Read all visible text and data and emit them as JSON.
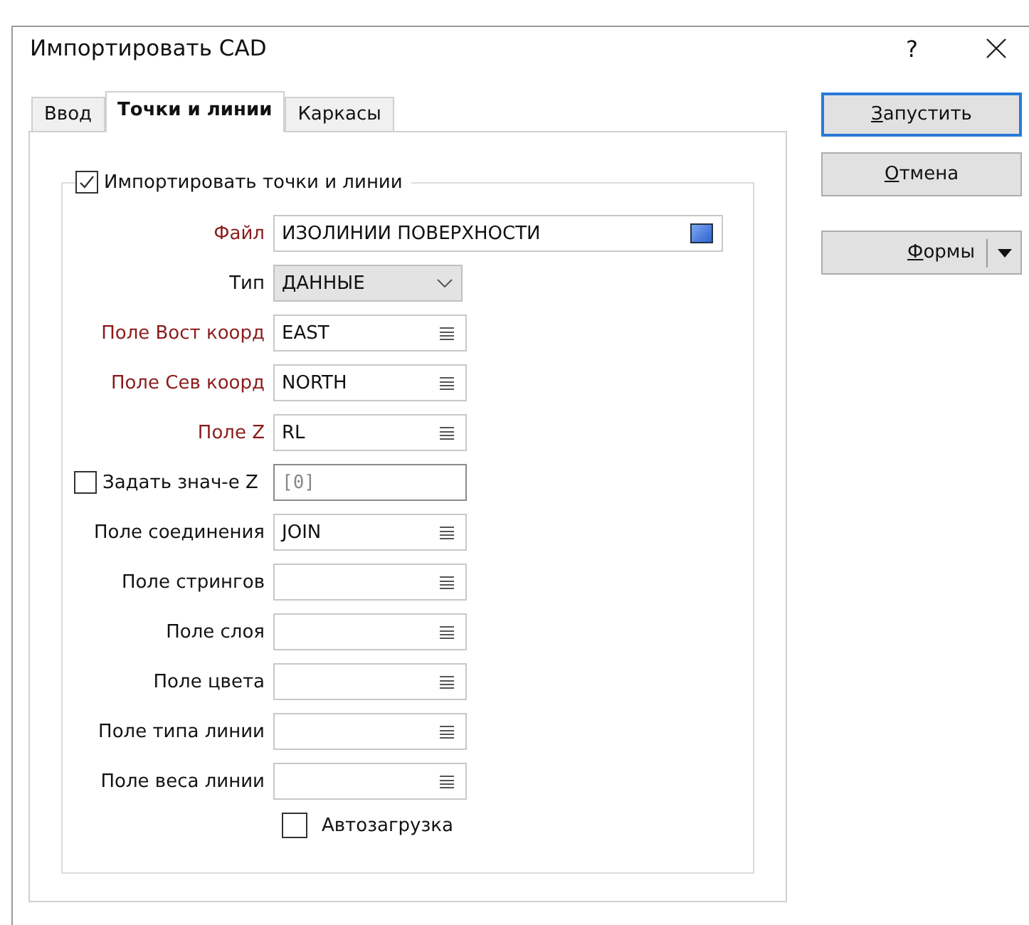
{
  "window": {
    "title": "Импортировать CAD",
    "help": "?"
  },
  "tabs": [
    {
      "label": "Ввод",
      "selected": false
    },
    {
      "label": "Точки и линии",
      "selected": true
    },
    {
      "label": "Каркасы",
      "selected": false
    }
  ],
  "group": {
    "label": "Импортировать точки и линии",
    "checked": true
  },
  "rows": [
    {
      "kind": "file",
      "label": "Файл",
      "required": true,
      "value": "ИЗОЛИНИИ ПОВЕРХНОСТИ"
    },
    {
      "kind": "select",
      "label": "Тип",
      "required": false,
      "value": "ДАННЫЕ"
    },
    {
      "kind": "field",
      "label": "Поле Вост коорд",
      "required": true,
      "value": "EAST"
    },
    {
      "kind": "field",
      "label": "Поле Сев коорд",
      "required": true,
      "value": "NORTH"
    },
    {
      "kind": "field",
      "label": "Поле Z",
      "required": true,
      "value": "RL"
    },
    {
      "kind": "check_value",
      "label": "Задать знач-е Z",
      "checked": false,
      "placeholder": "[0]"
    },
    {
      "kind": "field",
      "label": "Поле соединения",
      "required": false,
      "value": "JOIN"
    },
    {
      "kind": "field",
      "label": "Поле стрингов",
      "required": false
    },
    {
      "kind": "field",
      "label": "Поле слоя",
      "required": false
    },
    {
      "kind": "field",
      "label": "Поле цвета",
      "required": false
    },
    {
      "kind": "field",
      "label": "Поле типа линии",
      "required": false
    },
    {
      "kind": "field",
      "label": "Поле веса линии",
      "required": false
    }
  ],
  "autoload": {
    "label": "Автозагрузка",
    "checked": false
  },
  "buttons": [
    {
      "kind": "push",
      "label": "Запустить",
      "default": true,
      "access_key_underlined": true
    },
    {
      "kind": "push",
      "label": "Отмена",
      "default": false,
      "access_key_underlined": true
    },
    {
      "kind": "split",
      "label": "Формы",
      "default": false,
      "access_key_underlined": true
    }
  ]
}
